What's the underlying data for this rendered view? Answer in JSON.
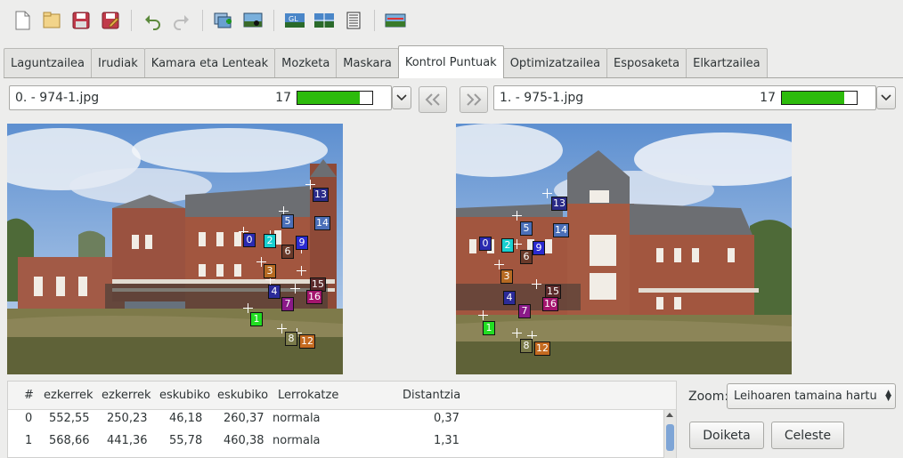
{
  "toolbar": {
    "icons": [
      "new-icon",
      "open-icon",
      "save-icon",
      "save-as-icon",
      "undo-icon",
      "redo-icon",
      "add-images-icon",
      "add-control-points-icon",
      "gl-preview-icon",
      "fast-preview-icon",
      "log-icon",
      "pano-icon"
    ]
  },
  "tabs": [
    {
      "label": "Laguntzailea",
      "active": false
    },
    {
      "label": "Irudiak",
      "active": false
    },
    {
      "label": "Kamara eta Lenteak",
      "active": false
    },
    {
      "label": "Mozketa",
      "active": false
    },
    {
      "label": "Maskara",
      "active": false
    },
    {
      "label": "Kontrol Puntuak",
      "active": true
    },
    {
      "label": "Optimizatzailea",
      "active": false
    },
    {
      "label": "Esposaketa",
      "active": false
    },
    {
      "label": "Elkartzailea",
      "active": false
    }
  ],
  "left_image": {
    "name": "0. - 974-1.jpg",
    "count": "17",
    "progress": 0.83
  },
  "right_image": {
    "name": "1. - 975-1.jpg",
    "count": "17",
    "progress": 0.83
  },
  "left_points": [
    {
      "id": "0",
      "color": "#2a2ab0"
    },
    {
      "id": "1",
      "color": "#22dd22"
    },
    {
      "id": "2",
      "color": "#18d0d0"
    },
    {
      "id": "3",
      "color": "#b66a22"
    },
    {
      "id": "4",
      "color": "#2b2b99"
    },
    {
      "id": "5",
      "color": "#4b6fb8"
    },
    {
      "id": "6",
      "color": "#6a3a2a"
    },
    {
      "id": "7",
      "color": "#8a1a88"
    },
    {
      "id": "8",
      "color": "#7a7a4a"
    },
    {
      "id": "9",
      "color": "#2a2ad0"
    },
    {
      "id": "12",
      "color": "#c46a20"
    },
    {
      "id": "13",
      "color": "#2a2a88"
    },
    {
      "id": "14",
      "color": "#4b6fb8"
    },
    {
      "id": "15",
      "color": "#5a2a2a"
    },
    {
      "id": "16",
      "color": "#a4166e"
    }
  ],
  "right_points": [
    {
      "id": "0",
      "color": "#2a2ab0"
    },
    {
      "id": "1",
      "color": "#22dd22"
    },
    {
      "id": "2",
      "color": "#18d0d0"
    },
    {
      "id": "3",
      "color": "#b66a22"
    },
    {
      "id": "4",
      "color": "#2b2b99"
    },
    {
      "id": "5",
      "color": "#4b6fb8"
    },
    {
      "id": "6",
      "color": "#6a3a2a"
    },
    {
      "id": "7",
      "color": "#8a1a88"
    },
    {
      "id": "8",
      "color": "#7a7a4a"
    },
    {
      "id": "9",
      "color": "#2a2ad0"
    },
    {
      "id": "12",
      "color": "#c46a20"
    },
    {
      "id": "13",
      "color": "#2a2a88"
    },
    {
      "id": "14",
      "color": "#4b6fb8"
    },
    {
      "id": "15",
      "color": "#5a2a2a"
    },
    {
      "id": "16",
      "color": "#a4166e"
    }
  ],
  "table": {
    "headers": [
      "#",
      "ezkerrek",
      "ezkerrek",
      "eskubiko",
      "eskubiko",
      "Lerrokatze",
      "Distantzia"
    ],
    "rows": [
      [
        "0",
        "552,55",
        "250,23",
        "46,18",
        "260,37",
        "normala",
        "0,37"
      ],
      [
        "1",
        "568,66",
        "441,36",
        "55,78",
        "460,38",
        "normala",
        "1,31"
      ]
    ]
  },
  "zoom": {
    "label": "Zoom:",
    "value": "Leihoaren tamaina hartu"
  },
  "buttons": {
    "delete": "Doiketa",
    "fine_tune": "Celeste"
  }
}
